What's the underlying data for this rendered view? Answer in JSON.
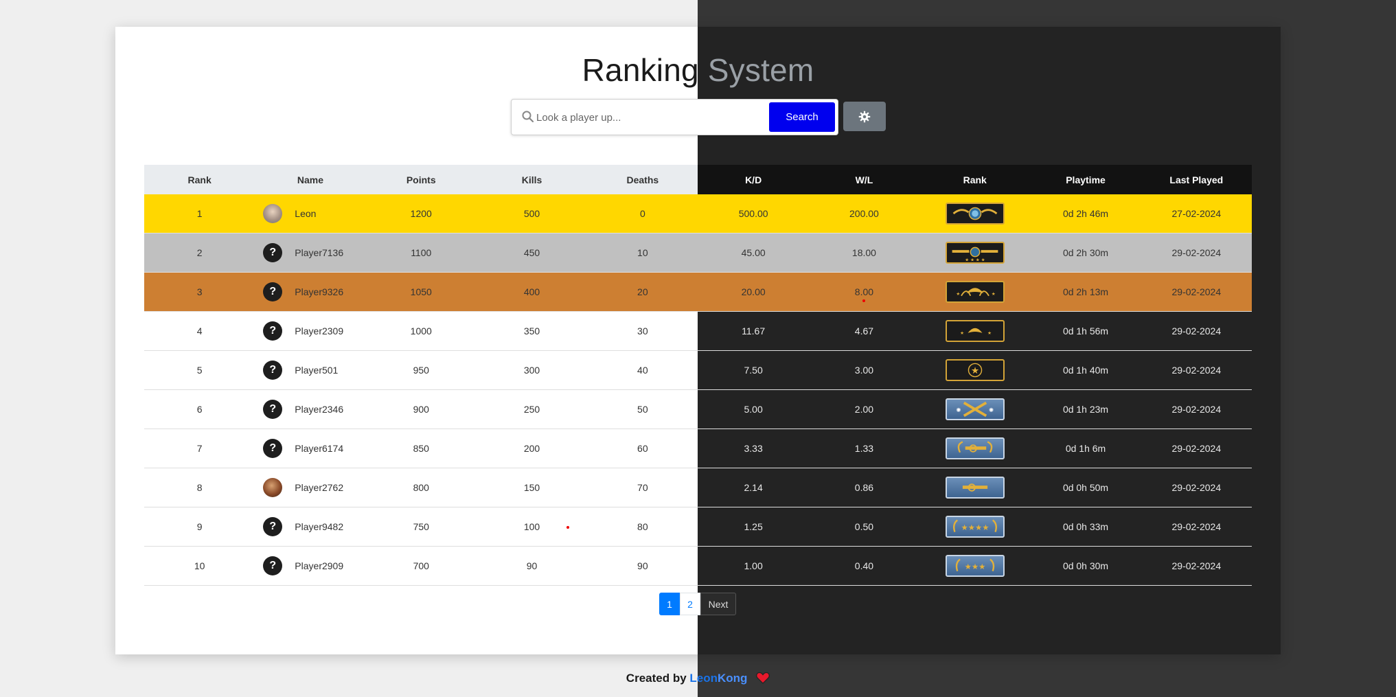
{
  "header": {
    "title_word1": "Ranking",
    "title_word2": "System"
  },
  "search": {
    "placeholder": "Look a player up...",
    "button_label": "Search"
  },
  "table": {
    "columns": [
      "Rank",
      "Name",
      "Points",
      "Kills",
      "Deaths",
      "K/D",
      "W/L",
      "Rank",
      "Playtime",
      "Last Played"
    ],
    "rows": [
      {
        "rank": "1",
        "name": "Leon",
        "points": "1200",
        "kills": "500",
        "deaths": "0",
        "kd": "500.00",
        "wl": "200.00",
        "playtime": "0d 2h 46m",
        "last_played": "27-02-2024",
        "avatar": "photo",
        "badge": "global-elite"
      },
      {
        "rank": "2",
        "name": "Player7136",
        "points": "1100",
        "kills": "450",
        "deaths": "10",
        "kd": "45.00",
        "wl": "18.00",
        "playtime": "0d 2h 30m",
        "last_played": "29-02-2024",
        "avatar": "unknown",
        "badge": "supreme"
      },
      {
        "rank": "3",
        "name": "Player9326",
        "points": "1050",
        "kills": "400",
        "deaths": "20",
        "kd": "20.00",
        "wl": "8.00",
        "playtime": "0d 2h 13m",
        "last_played": "29-02-2024",
        "avatar": "unknown",
        "badge": "legendary-eagle-master"
      },
      {
        "rank": "4",
        "name": "Player2309",
        "points": "1000",
        "kills": "350",
        "deaths": "30",
        "kd": "11.67",
        "wl": "4.67",
        "playtime": "0d 1h 56m",
        "last_played": "29-02-2024",
        "avatar": "unknown",
        "badge": "legendary-eagle"
      },
      {
        "rank": "5",
        "name": "Player501",
        "points": "950",
        "kills": "300",
        "deaths": "40",
        "kd": "7.50",
        "wl": "3.00",
        "playtime": "0d 1h 40m",
        "last_played": "29-02-2024",
        "avatar": "unknown",
        "badge": "distinguished-master-guardian"
      },
      {
        "rank": "6",
        "name": "Player2346",
        "points": "900",
        "kills": "250",
        "deaths": "50",
        "kd": "5.00",
        "wl": "2.00",
        "playtime": "0d 1h 23m",
        "last_played": "29-02-2024",
        "avatar": "unknown",
        "badge": "master-guardian-elite"
      },
      {
        "rank": "7",
        "name": "Player6174",
        "points": "850",
        "kills": "200",
        "deaths": "60",
        "kd": "3.33",
        "wl": "1.33",
        "playtime": "0d 1h 6m",
        "last_played": "29-02-2024",
        "avatar": "unknown",
        "badge": "master-guardian-2"
      },
      {
        "rank": "8",
        "name": "Player2762",
        "points": "800",
        "kills": "150",
        "deaths": "70",
        "kd": "2.14",
        "wl": "0.86",
        "playtime": "0d 0h 50m",
        "last_played": "29-02-2024",
        "avatar": "photo2",
        "badge": "master-guardian-1"
      },
      {
        "rank": "9",
        "name": "Player9482",
        "points": "750",
        "kills": "100",
        "deaths": "80",
        "kd": "1.25",
        "wl": "0.50",
        "playtime": "0d 0h 33m",
        "last_played": "29-02-2024",
        "avatar": "unknown",
        "badge": "gold-nova-master"
      },
      {
        "rank": "10",
        "name": "Player2909",
        "points": "700",
        "kills": "90",
        "deaths": "90",
        "kd": "1.00",
        "wl": "0.40",
        "playtime": "0d 0h 30m",
        "last_played": "29-02-2024",
        "avatar": "unknown",
        "badge": "gold-nova-3"
      }
    ]
  },
  "pagination": {
    "pages": [
      "1",
      "2"
    ],
    "current": "1",
    "next_label": "Next"
  },
  "footer": {
    "prefix": "Created by",
    "author_part1": "Leon",
    "author_part2": "Kong"
  },
  "icons": {
    "search": "search-icon",
    "settings": "gear-icon",
    "heart": "heart-icon",
    "unknown_avatar": "question-mark"
  },
  "colors": {
    "gold": "#ffd700",
    "silver": "#c0c0c0",
    "bronze": "#cd7f32",
    "search_button": "#0000ee",
    "accent": "#007bff"
  }
}
